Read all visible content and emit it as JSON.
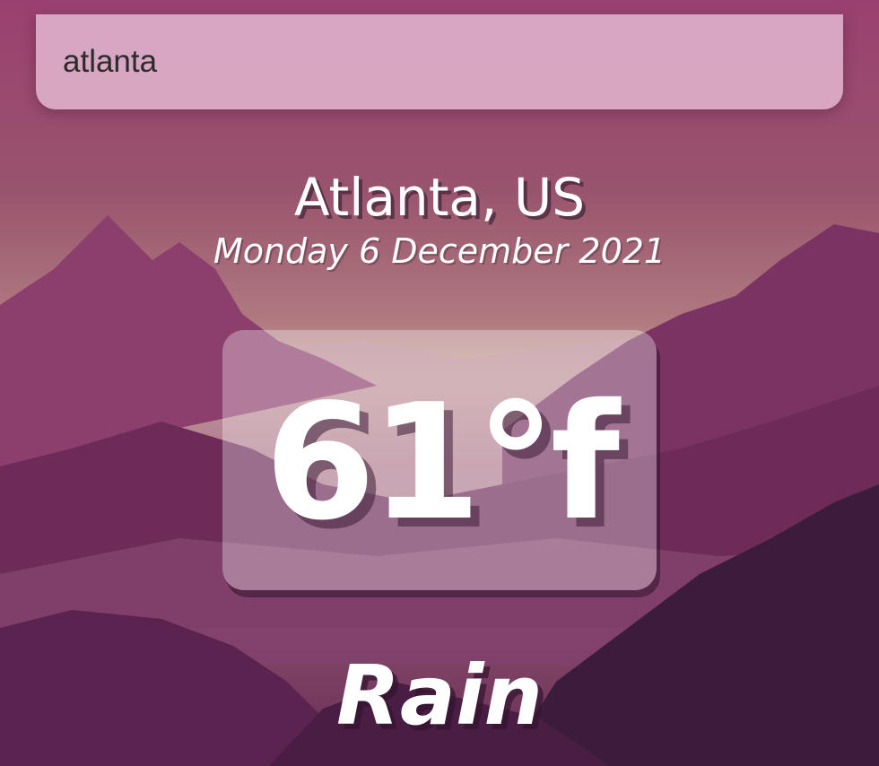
{
  "search": {
    "value": "atlanta"
  },
  "location": {
    "city_country": "Atlanta, US",
    "date": "Monday 6 December 2021"
  },
  "weather": {
    "temperature": "61°f",
    "condition": "Rain"
  },
  "colors": {
    "sky_top": "#8a3f6a",
    "sky_glow": "#c49a8f",
    "mountain_far": "#9a5478",
    "mountain_mid": "#7a2f60",
    "mountain_near": "#3a1c3a"
  }
}
